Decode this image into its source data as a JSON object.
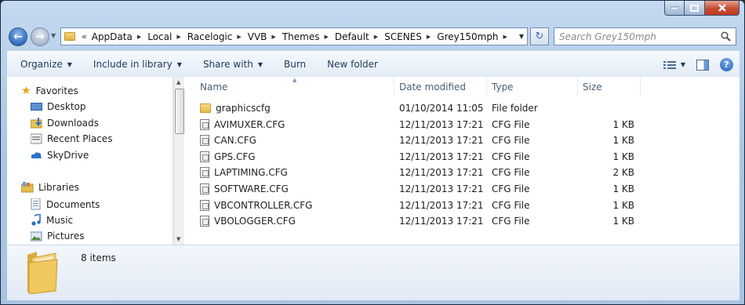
{
  "window": {
    "minimize": "–",
    "maximize": "□",
    "close": "✕"
  },
  "address": {
    "overflow": "«",
    "crumbs": [
      "AppData",
      "Local",
      "Racelogic",
      "VVB",
      "Themes",
      "Default",
      "SCENES",
      "Grey150mph"
    ]
  },
  "search": {
    "placeholder": "Search Grey150mph"
  },
  "toolbar": {
    "organize": "Organize",
    "include": "Include in library",
    "share": "Share with",
    "burn": "Burn",
    "new_folder": "New folder"
  },
  "nav": {
    "favorites": "Favorites",
    "favorite_items": [
      "Desktop",
      "Downloads",
      "Recent Places",
      "SkyDrive"
    ],
    "libraries": "Libraries",
    "library_items": [
      "Documents",
      "Music",
      "Pictures"
    ]
  },
  "columns": {
    "name": "Name",
    "date": "Date modified",
    "type": "Type",
    "size": "Size"
  },
  "files": [
    {
      "name": "graphicscfg",
      "date": "01/10/2014 11:05",
      "type": "File folder",
      "size": "",
      "kind": "folder"
    },
    {
      "name": "AVIMUXER.CFG",
      "date": "12/11/2013 17:21",
      "type": "CFG File",
      "size": "1 KB",
      "kind": "file"
    },
    {
      "name": "CAN.CFG",
      "date": "12/11/2013 17:21",
      "type": "CFG File",
      "size": "1 KB",
      "kind": "file"
    },
    {
      "name": "GPS.CFG",
      "date": "12/11/2013 17:21",
      "type": "CFG File",
      "size": "1 KB",
      "kind": "file"
    },
    {
      "name": "LAPTIMING.CFG",
      "date": "12/11/2013 17:21",
      "type": "CFG File",
      "size": "2 KB",
      "kind": "file"
    },
    {
      "name": "SOFTWARE.CFG",
      "date": "12/11/2013 17:21",
      "type": "CFG File",
      "size": "1 KB",
      "kind": "file"
    },
    {
      "name": "VBCONTROLLER.CFG",
      "date": "12/11/2013 17:21",
      "type": "CFG File",
      "size": "1 KB",
      "kind": "file"
    },
    {
      "name": "VBOLOGGER.CFG",
      "date": "12/11/2013 17:21",
      "type": "CFG File",
      "size": "1 KB",
      "kind": "file"
    }
  ],
  "details": {
    "count": "8 items"
  }
}
